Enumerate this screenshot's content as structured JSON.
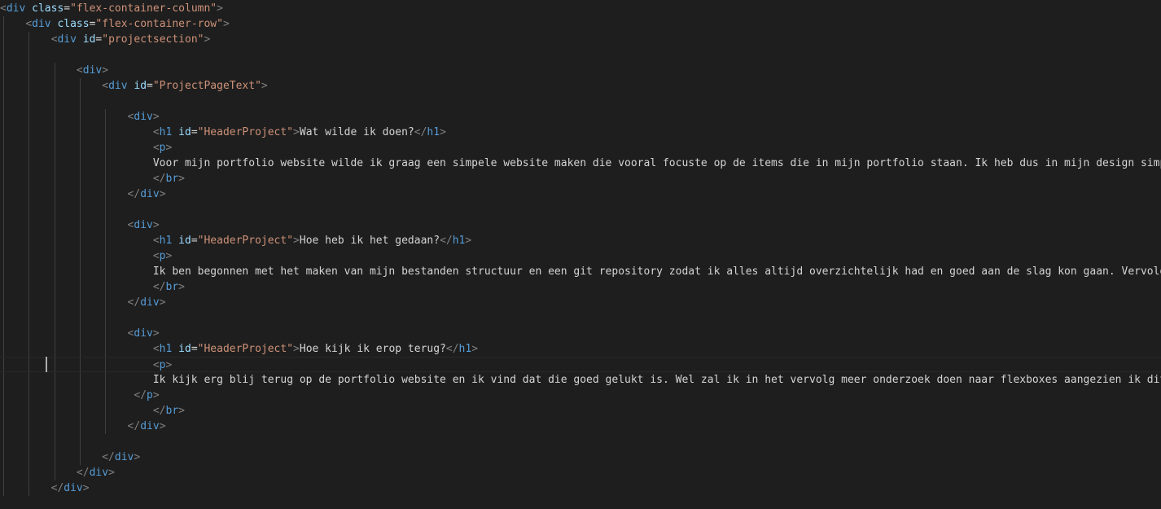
{
  "editor": {
    "language": "html",
    "indent_unit": "    ",
    "cursor_line": 23,
    "lines": [
      {
        "indent": 0,
        "kind": "open",
        "tag": "div",
        "attr": "class",
        "value": "flex-container-column"
      },
      {
        "indent": 1,
        "kind": "open",
        "tag": "div",
        "attr": "class",
        "value": "flex-container-row"
      },
      {
        "indent": 2,
        "kind": "open",
        "tag": "div",
        "attr": "id",
        "value": "projectsection"
      },
      {
        "indent": 0,
        "kind": "blank"
      },
      {
        "indent": 3,
        "kind": "open",
        "tag": "div"
      },
      {
        "indent": 4,
        "kind": "open",
        "tag": "div",
        "attr": "id",
        "value": "ProjectPageText"
      },
      {
        "indent": 0,
        "kind": "blank"
      },
      {
        "indent": 5,
        "kind": "open",
        "tag": "div"
      },
      {
        "indent": 6,
        "kind": "element",
        "tag": "h1",
        "attr": "id",
        "value": "HeaderProject",
        "text": "Wat wilde ik doen?"
      },
      {
        "indent": 6,
        "kind": "open",
        "tag": "p"
      },
      {
        "indent": 6,
        "kind": "text",
        "text": "Voor mijn portfolio website wilde ik graag een simpele website maken die vooral focuste op de items die in mijn portfolio staan. Ik heb dus in mijn design simpel"
      },
      {
        "indent": 6,
        "kind": "close",
        "tag": "br"
      },
      {
        "indent": 5,
        "kind": "close",
        "tag": "div"
      },
      {
        "indent": 0,
        "kind": "blank"
      },
      {
        "indent": 5,
        "kind": "open",
        "tag": "div"
      },
      {
        "indent": 6,
        "kind": "element",
        "tag": "h1",
        "attr": "id",
        "value": "HeaderProject",
        "text": "Hoe heb ik het gedaan?"
      },
      {
        "indent": 6,
        "kind": "open",
        "tag": "p"
      },
      {
        "indent": 6,
        "kind": "text",
        "text": "Ik ben begonnen met het maken van mijn bestanden structuur en een git repository zodat ik alles altijd overzichtelijk had en goed aan de slag kon gaan. Vervolgens"
      },
      {
        "indent": 6,
        "kind": "close",
        "tag": "br"
      },
      {
        "indent": 5,
        "kind": "close",
        "tag": "div"
      },
      {
        "indent": 0,
        "kind": "blank"
      },
      {
        "indent": 5,
        "kind": "open",
        "tag": "div"
      },
      {
        "indent": 6,
        "kind": "element",
        "tag": "h1",
        "attr": "id",
        "value": "HeaderProject",
        "text": "Hoe kijk ik erop terug?"
      },
      {
        "indent": 6,
        "kind": "open",
        "tag": "p"
      },
      {
        "indent": 6,
        "kind": "text",
        "text": "Ik kijk erg blij terug op de portfolio website en ik vind dat die goed gelukt is. Wel zal ik in het vervolg meer onderzoek doen naar flexboxes aangezien ik dit"
      },
      {
        "indent": 5,
        "prefix": " ",
        "kind": "close",
        "tag": "p"
      },
      {
        "indent": 6,
        "kind": "close",
        "tag": "br"
      },
      {
        "indent": 5,
        "kind": "close",
        "tag": "div"
      },
      {
        "indent": 0,
        "kind": "blank"
      },
      {
        "indent": 4,
        "kind": "close",
        "tag": "div"
      },
      {
        "indent": 3,
        "kind": "close",
        "tag": "div"
      },
      {
        "indent": 2,
        "kind": "close",
        "tag": "div"
      }
    ]
  }
}
